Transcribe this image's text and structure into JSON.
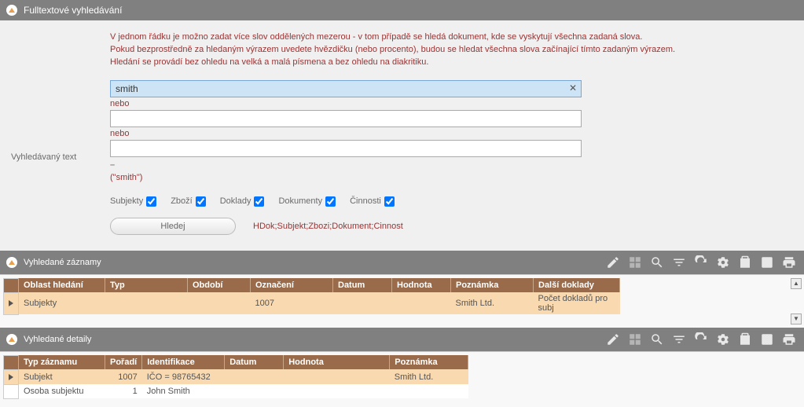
{
  "fulltext": {
    "title": "Fulltextové vyhledávání",
    "help_line1": "V jednom řádku je možno zadat více slov oddělených mezerou - v tom případě se hledá dokument, kde se vyskytují všechna zadaná slova.",
    "help_line2": "Pokud bezprostředně za hledaným výrazem uvedete hvězdičku (nebo procento), budou se hledat všechna slova začínající tímto zadaným výrazem.",
    "help_line3": "Hledání se provádí bez ohledu na velká a malá písmena a bez ohledu na diakritiku.",
    "label_search_text": "Vyhledávaný text",
    "input1": "smith",
    "nebo": "nebo",
    "input2": "",
    "input3": "",
    "query_preview": "(\"smith\")",
    "checks": {
      "subjekty": "Subjekty",
      "zbozi": "Zboží",
      "doklady": "Doklady",
      "dokumenty": "Dokumenty",
      "cinnosti": "Činnosti"
    },
    "btn_search": "Hledej",
    "search_scope": "HDok;Subjekt;Zbozi;Dokument;Cinnost"
  },
  "records": {
    "title": "Vyhledané záznamy",
    "cols": {
      "oblast": "Oblast hledání",
      "typ": "Typ",
      "obdobi": "Období",
      "oznaceni": "Označení",
      "datum": "Datum",
      "hodnota": "Hodnota",
      "poznamka": "Poznámka",
      "dalsi": "Další doklady"
    },
    "rows": [
      {
        "oblast": "Subjekty",
        "typ": "",
        "obdobi": "",
        "oznaceni": "1007",
        "datum": "",
        "hodnota": "",
        "poznamka": "Smith Ltd.",
        "dalsi": "Počet dokladů pro subj"
      }
    ]
  },
  "details": {
    "title": "Vyhledané detaily",
    "cols": {
      "typ": "Typ záznamu",
      "poradi": "Pořadí",
      "ident": "Identifikace",
      "datum": "Datum",
      "hodnota": "Hodnota",
      "poznamka": "Poznámka"
    },
    "rows": [
      {
        "typ": "Subjekt",
        "poradi": "1007",
        "ident": "IČO = 98765432",
        "datum": "",
        "hodnota": "",
        "poznamka": "Smith Ltd."
      },
      {
        "typ": "Osoba subjektu",
        "poradi": "1",
        "ident": "John Smith",
        "datum": "",
        "hodnota": "",
        "poznamka": ""
      }
    ]
  }
}
